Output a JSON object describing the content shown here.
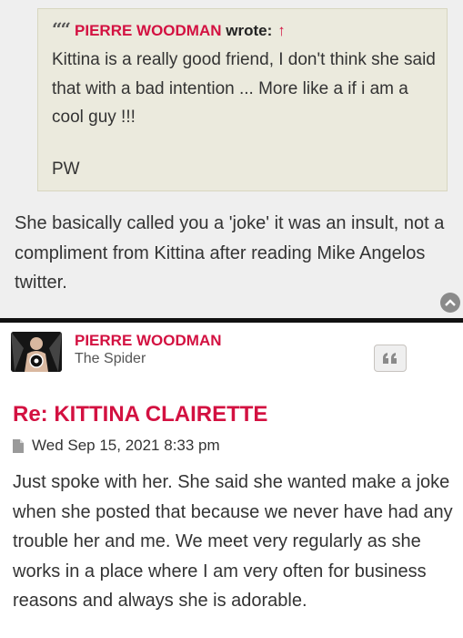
{
  "post1": {
    "quote": {
      "mark": "““",
      "author": "PIERRE WOODMAN",
      "wrote": "wrote:",
      "arrow": "↑",
      "body": "Kittina is a really good friend, I don't think she said that with a bad intention ... More like a if i am a cool guy !!!",
      "sign": "PW"
    },
    "reply": "She basically called you a 'joke' it was an insult, not a compliment from Kittina after reading Mike Angelos twitter."
  },
  "post2": {
    "username": "PIERRE WOODMAN",
    "rank": "The Spider",
    "title": "Re: KITTINA CLAIRETTE",
    "date": "Wed Sep 15, 2021 8:33 pm",
    "body": "Just spoke with her. She said she wanted make a joke when she posted that because we never have had any trouble her and me. We meet very regularly as she works in a place where I am very often for business reasons and always she is adorable."
  },
  "icons": {
    "top": "chevron-up-icon",
    "quote": "quote-icon",
    "file": "file-icon"
  },
  "colors": {
    "accent": "#d31141",
    "quote_bg": "#ebeadd",
    "post_bg": "#efefef"
  }
}
